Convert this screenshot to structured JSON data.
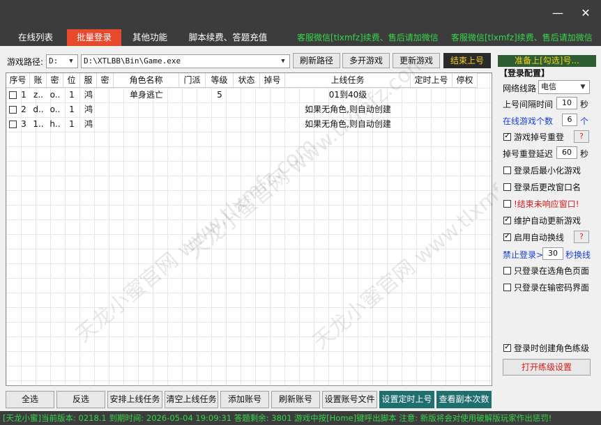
{
  "window": {
    "minimize": "—",
    "close": "✕"
  },
  "tabs": [
    "在线列表",
    "批量登录",
    "其他功能",
    "脚本续费、答题充值"
  ],
  "active_tab": 1,
  "notes": [
    "客服微信[tlxmfz]续费、售后请加微信",
    "客服微信[tlxmfz]续费、售后请加微信"
  ],
  "path": {
    "label": "游戏路径:",
    "drive": "D:",
    "value": "D:\\XTLBB\\Bin\\Game.exe"
  },
  "toolbar": {
    "refresh_path": "刷新路径",
    "multi_open": "多开游戏",
    "update_game": "更新游戏",
    "end_login": "结束上号"
  },
  "table": {
    "headers": [
      "序号",
      "账",
      "密",
      "位",
      "服",
      "密",
      "角色名称",
      "门派",
      "等级",
      "状态",
      "掉号",
      "上线任务",
      "定时上号",
      "停权"
    ],
    "rows": [
      {
        "no": "1",
        "account": "z..",
        "pwd": "o..",
        "pos": "1",
        "server": "鸿",
        "pwd2": "",
        "role": "单身逃亡",
        "sect": "",
        "level": "5",
        "status": "",
        "drop": "",
        "task": "01到40级",
        "timer": "",
        "ban": ""
      },
      {
        "no": "2",
        "account": "d..",
        "pwd": "o..",
        "pos": "1",
        "server": "鸿",
        "pwd2": "",
        "role": "",
        "sect": "",
        "level": "",
        "status": "",
        "drop": "",
        "task": "如果无角色,则自动创建",
        "timer": "",
        "ban": ""
      },
      {
        "no": "3",
        "account": "1..",
        "pwd": "h..",
        "pos": "1",
        "server": "鸿",
        "pwd2": "",
        "role": "",
        "sect": "",
        "level": "",
        "status": "",
        "drop": "",
        "task": "如果无角色,则自动创建",
        "timer": "",
        "ban": ""
      }
    ]
  },
  "bottom_buttons": [
    "全选",
    "反选",
    "安排上线任务",
    "清空上线任务",
    "添加账号",
    "刷新账号",
    "设置账号文件",
    "设置定时上号",
    "查看副本次数"
  ],
  "panel": {
    "ready": "准备上[勾选]号...",
    "section": "【登录配置】",
    "network_label": "网络线路",
    "network_value": "电信",
    "interval_label": "上号间隔时间",
    "interval_value": "10",
    "interval_unit": "秒",
    "online_count_label": "在线游戏个数",
    "online_count_value": "6",
    "online_count_unit": "个",
    "relogin_label": "游戏掉号重登",
    "relogin_delay_label": "掉号重登延迟",
    "relogin_delay_value": "60",
    "relogin_delay_unit": "秒",
    "minimize_label": "登录后最小化游戏",
    "rename_label": "登录后更改窗口名",
    "kill_label": "!结束未响应窗口!",
    "auto_update_label": "维护自动更新游戏",
    "auto_switch_label": "启用自动换线",
    "forbid_label": "禁止登录>",
    "forbid_value": "30",
    "forbid_unit": "秒换线",
    "only_select_label": "只登录在选角色页面",
    "only_pwd_label": "只登录在输密码界面",
    "create_role_label": "登录时创建角色练级",
    "open_level_button": "打开练级设置",
    "question": "?"
  },
  "status_bar": "[天龙小蜜]当前版本: 0218.1   到期时间: 2026-05-04 19:09:31   答题剩余: 3801   游戏中按[Home]键呼出脚本   注意: 新版将会对使用破解版玩家作出惩罚!",
  "watermark": "天龙小蜜官网 www.tlxmfz.com",
  "colors": {
    "accent": "#e8492c",
    "green": "#35d64a",
    "yellow": "#f5d31a",
    "teal": "#1f6e70"
  }
}
